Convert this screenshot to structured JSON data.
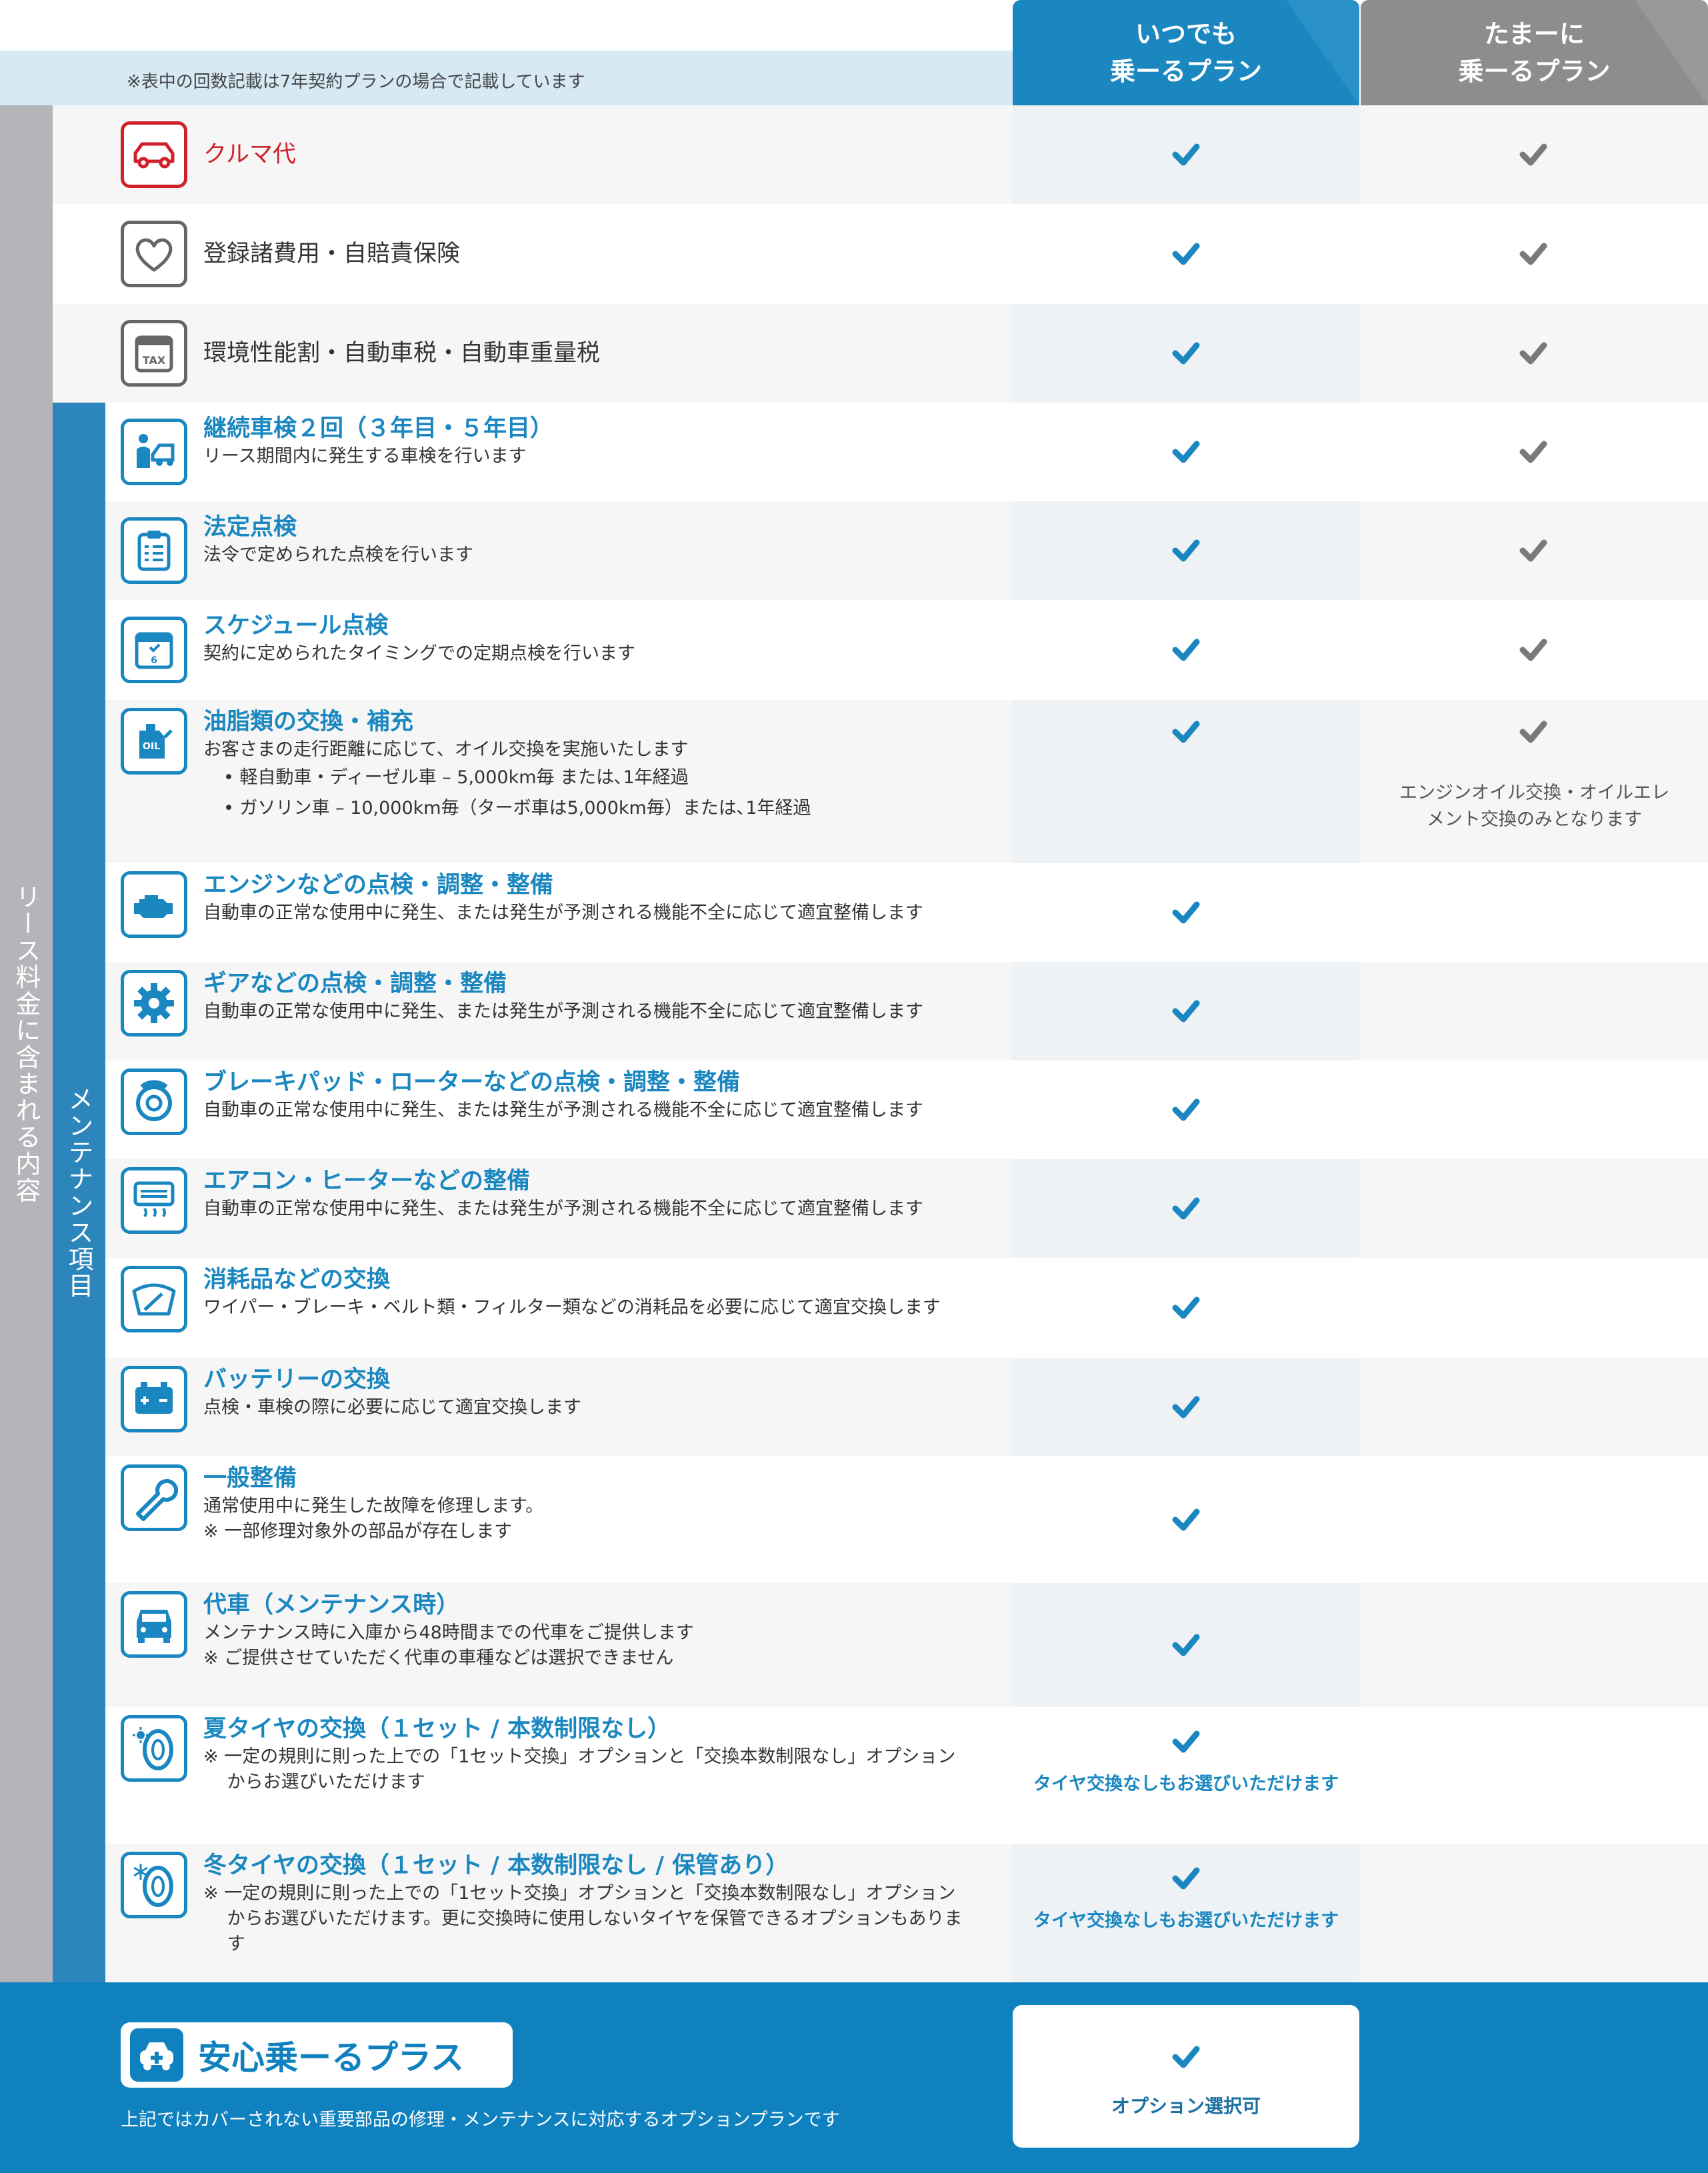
{
  "header": {
    "note": "※表中の回数記載は7年契約プランの場合で記載しています",
    "plans": [
      {
        "label": "いつでも\n乗ーるプラン",
        "color": "#1a87c0"
      },
      {
        "label": "たまーに\n乗ーるプラン",
        "color": "#8d8d8d"
      }
    ]
  },
  "side": {
    "lease_label": "リース料金に含まれる内容",
    "maintenance_label": "メンテナンス項目"
  },
  "colors": {
    "accent_blue": "#1a87c0",
    "check_blue": "#1a87c0",
    "check_gray": "#7a7a7a",
    "kuruma_red": "#d0202a",
    "footer_blue": "#0f81bf"
  },
  "rows": [
    {
      "icon": "car-icon",
      "title": "クルマ代"
    },
    {
      "icon": "heart-icon",
      "title": "登録諸費用・自賠責保険"
    },
    {
      "icon": "tax-icon",
      "title": "環境性能割・自動車税・自動車重量税"
    },
    {
      "icon": "mechanic-icon",
      "title": "継続車検２回（３年目・５年目）",
      "desc": "リース期間内に発生する車検を行います"
    },
    {
      "icon": "clipboard-icon",
      "title": "法定点検",
      "desc": "法令で定められた点検を行います"
    },
    {
      "icon": "calendar-6-month-icon",
      "title": "スケジュール点検",
      "desc": "契約に定められたタイミングでの定期点検を行います"
    },
    {
      "icon": "oil-can-icon",
      "title": "油脂類の交換・補充",
      "desc": "お客さまの走行距離に応じて、オイル交換を実施いたします",
      "bullets": [
        "軽自動車・ディーゼル車 – 5,000km毎 または､1年経過",
        "ガソリン車 – 10,000km毎（ターボ車は5,000km毎）または､1年経過"
      ],
      "note_tamani": "エンジンオイル交換・オイルエレ\nメント交換のみとなります"
    },
    {
      "icon": "engine-icon",
      "title": "エンジンなどの点検・調整・整備",
      "desc": "自動車の正常な使用中に発生、または発生が予測される機能不全に応じて適宜整備します"
    },
    {
      "icon": "gear-icon",
      "title": "ギアなどの点検・調整・整備",
      "desc": "自動車の正常な使用中に発生、または発生が予測される機能不全に応じて適宜整備します"
    },
    {
      "icon": "brake-disc-icon",
      "title": "ブレーキパッド・ローターなどの点検・調整・整備",
      "desc": "自動車の正常な使用中に発生、または発生が予測される機能不全に応じて適宜整備します"
    },
    {
      "icon": "air-conditioner-icon",
      "title": "エアコン・ヒーターなどの整備",
      "desc": "自動車の正常な使用中に発生、または発生が予測される機能不全に応じて適宜整備します"
    },
    {
      "icon": "wiper-icon",
      "title": "消耗品などの交換",
      "desc": "ワイパー・ブレーキ・ベルト類・フィルター類などの消耗品を必要に応じて適宜交換します"
    },
    {
      "icon": "battery-icon",
      "title": "バッテリーの交換",
      "desc": "点検・車検の際に必要に応じて適宜交換します"
    },
    {
      "icon": "wrench-icon",
      "title": "一般整備",
      "desc": "通常使用中に発生した故障を修理します。\n※ 一部修理対象外の部品が存在します"
    },
    {
      "icon": "car-front-icon",
      "title": "代車（メンテナンス時）",
      "desc": "メンテナンス時に入庫から48時間までの代車をご提供します\n※ ご提供させていただく代車の車種などは選択できません"
    },
    {
      "icon": "summer-tire-icon",
      "title": "夏タイヤの交換（１セット / 本数制限なし）",
      "desc": "※ 一定の規則に則った上での「1セット交換」オプションと「交換本数制限なし」オプション\n　 からお選びいただけます",
      "note_itsudemo": "タイヤ交換なしもお選びいただけます"
    },
    {
      "icon": "winter-tire-icon",
      "title": "冬タイヤの交換（１セット / 本数制限なし / 保管あり）",
      "desc": "※ 一定の規則に則った上での「1セット交換」オプションと「交換本数制限なし」オプション\n　 からお選びいただけます。更に交換時に使用しないタイヤを保管できるオプションもありま\n　 す",
      "note_itsudemo": "タイヤ交換なしもお選びいただけます"
    }
  ],
  "footer": {
    "title": "安心乗ーるプラス",
    "icon": "car-medical-cross-icon",
    "desc": "上記ではカバーされない重要部品の修理・メンテナンスに対応するオプションプランです",
    "option_label": "オプション選択可"
  }
}
